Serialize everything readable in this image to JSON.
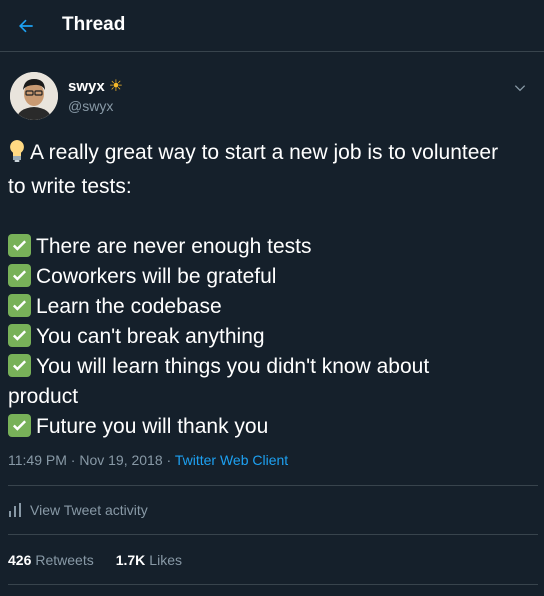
{
  "header": {
    "title": "Thread",
    "back_icon": "arrow-left-icon"
  },
  "author": {
    "name": "swyx",
    "badge_emoji": "☀",
    "handle": "@swyx"
  },
  "tweet": {
    "intro_line1": "A really great way to start a new job is to volunteer",
    "intro_line2": "to write tests:",
    "items": [
      "There are never enough tests",
      "Coworkers will be grateful",
      "Learn the codebase",
      "You can't break anything",
      "You will learn things you didn't know about",
      "Future you will thank you"
    ],
    "item5_wrap": "product"
  },
  "meta": {
    "time": "11:49 PM",
    "separator": "·",
    "date": "Nov 19, 2018",
    "source": "Twitter Web Client"
  },
  "activity": {
    "label": "View Tweet activity"
  },
  "stats": {
    "retweets_count": "426",
    "retweets_label": "Retweets",
    "likes_count": "1.7K",
    "likes_label": "Likes"
  },
  "colors": {
    "background": "#15202b",
    "accent": "#1da1f2",
    "secondary_text": "#8899a6",
    "check": "#78b159"
  }
}
